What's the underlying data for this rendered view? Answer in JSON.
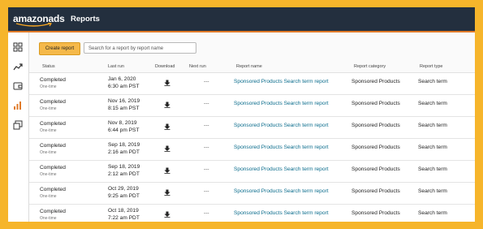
{
  "app": {
    "logo": "amazonads",
    "title": "Reports"
  },
  "toolbar": {
    "create_label": "Create report",
    "search_placeholder": "Search for a report by report name"
  },
  "columns": {
    "status": "Status",
    "last_run": "Last run",
    "download": "Download",
    "next_run": "Next run",
    "report_name": "Report name",
    "report_category": "Report category",
    "report_type": "Report type"
  },
  "rows": [
    {
      "status": "Completed",
      "frequency": "One-time",
      "date": "Jan 6, 2020",
      "time": "6:30 am PST",
      "next_run": "---",
      "name": "Sponsored Products Search term report",
      "category": "Sponsored Products",
      "type": "Search term"
    },
    {
      "status": "Completed",
      "frequency": "One-time",
      "date": "Nov 16, 2019",
      "time": "8:15 am PST",
      "next_run": "---",
      "name": "Sponsored Products Search term report",
      "category": "Sponsored Products",
      "type": "Search term"
    },
    {
      "status": "Completed",
      "frequency": "One-time",
      "date": "Nov 8, 2019",
      "time": "6:44 pm PST",
      "next_run": "---",
      "name": "Sponsored Products Search term report",
      "category": "Sponsored Products",
      "type": "Search term"
    },
    {
      "status": "Completed",
      "frequency": "One-time",
      "date": "Sep 18, 2019",
      "time": "2:16 am PDT",
      "next_run": "---",
      "name": "Sponsored Products Search term report",
      "category": "Sponsored Products",
      "type": "Search term"
    },
    {
      "status": "Completed",
      "frequency": "One-time",
      "date": "Sep 18, 2019",
      "time": "2:12 am PDT",
      "next_run": "---",
      "name": "Sponsored Products Search term report",
      "category": "Sponsored Products",
      "type": "Search term"
    },
    {
      "status": "Completed",
      "frequency": "One-time",
      "date": "Oct 29, 2019",
      "time": "9:25 am PDT",
      "next_run": "---",
      "name": "Sponsored Products Search term report",
      "category": "Sponsored Products",
      "type": "Search term"
    },
    {
      "status": "Completed",
      "frequency": "One-time",
      "date": "Oct 18, 2019",
      "time": "7:22 am PDT",
      "next_run": "---",
      "name": "Sponsored Products Search term report",
      "category": "Sponsored Products",
      "type": "Search term"
    }
  ],
  "sidebar": {
    "icons": [
      "dashboard-icon",
      "trend-icon",
      "wallet-icon",
      "reports-icon",
      "gallery-icon"
    ]
  },
  "colors": {
    "frame": "#f6b52b",
    "topbar": "#232f3e",
    "accent": "#e07b29",
    "link": "#0a6c8c",
    "button": "#f5b94a"
  }
}
